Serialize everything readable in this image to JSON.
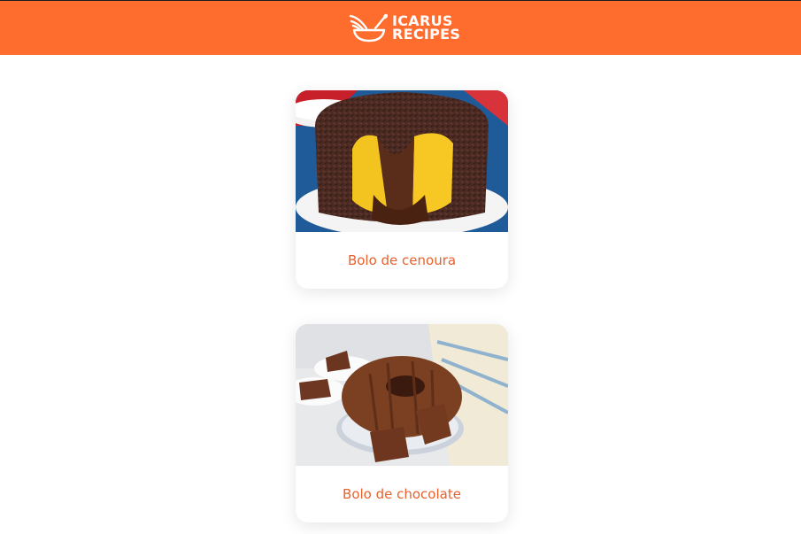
{
  "header": {
    "logo_line1": "ICARUS",
    "logo_line2": "RECIPES",
    "background_color": "#ff6d2e"
  },
  "recipes": [
    {
      "title": "Bolo de cenoura",
      "image": "carrot-cake-with-chocolate-sprinkles"
    },
    {
      "title": "Bolo de chocolate",
      "image": "chocolate-bundt-cake"
    }
  ]
}
